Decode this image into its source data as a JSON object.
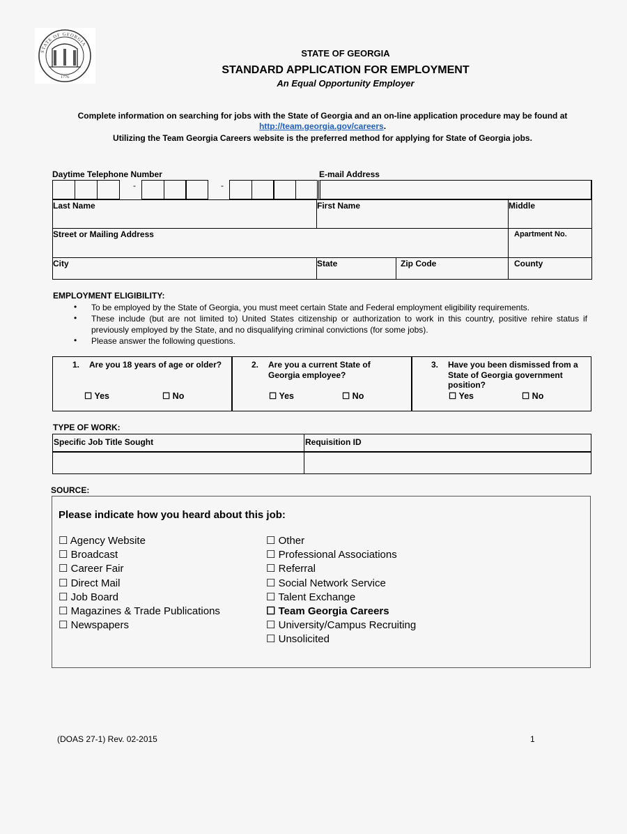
{
  "seal": {
    "icon": "state-of-georgia-seal",
    "ring_text": "STATE OF GEORGIA",
    "year": "1776"
  },
  "header": {
    "state": "STATE OF GEORGIA",
    "title": "STANDARD APPLICATION FOR EMPLOYMENT",
    "subtitle": "An Equal Opportunity Employer"
  },
  "intro": {
    "line1": "Complete information on searching for jobs with the State of Georgia and an on-line application procedure may be found at",
    "link": "http://team.georgia.gov/careers",
    "link_suffix": ".",
    "line3": "Utilizing the Team Georgia Careers website is the preferred method for applying for State of Georgia jobs."
  },
  "contact": {
    "phone_label": "Daytime Telephone Number",
    "phone_separator": "-",
    "email_label": "E-mail Address",
    "last_name": "Last Name",
    "first_name": "First Name",
    "middle": "Middle",
    "street": "Street or Mailing Address",
    "apartment": "Apartment No.",
    "city": "City",
    "state": "State",
    "zip": "Zip Code",
    "county": "County"
  },
  "eligibility": {
    "title": "EMPLOYMENT ELIGIBILITY:",
    "bullets": [
      "To be employed by the State of Georgia, you must meet certain State and Federal employment eligibility requirements.",
      "These include (but are not limited to) United States citizenship or authorization to work in this country, positive rehire status if previously employed by the State, and no disqualifying criminal convictions (for some jobs).",
      "Please answer the following questions."
    ],
    "bullet_glyph": "•",
    "questions": [
      {
        "num": "1.",
        "text": "Are you 18 years of age or older?",
        "yes": "☐ Yes",
        "no": "☐ No"
      },
      {
        "num": "2.",
        "text": "Are you a current State of Georgia employee?",
        "yes": "☐ Yes",
        "no": "☐ No"
      },
      {
        "num": "3.",
        "text": "Have you been dismissed from a State of Georgia government position?",
        "yes": "☐ Yes",
        "no": "☐ No"
      }
    ]
  },
  "type_of_work": {
    "title": "TYPE OF WORK:",
    "job_title_label": "Specific Job Title Sought",
    "requisition_label": "Requisition ID"
  },
  "source": {
    "title": "SOURCE:",
    "prompt": "Please indicate how you heard about this job:",
    "checkbox_glyph": "☐",
    "left_options": [
      "Agency Website",
      "Broadcast",
      "Career Fair",
      "Direct Mail",
      "Job Board",
      "Magazines & Trade Publications",
      "Newspapers"
    ],
    "right_options": [
      "Other",
      "Professional Associations",
      "Referral",
      "Social Network Service",
      "Talent Exchange",
      "Team Georgia Careers",
      "University/Campus Recruiting",
      "Unsolicited"
    ],
    "bold_option": "Team Georgia Careers"
  },
  "footer": {
    "form_id": "(DOAS 27-1) Rev. 02-2015",
    "page_number": "1"
  }
}
